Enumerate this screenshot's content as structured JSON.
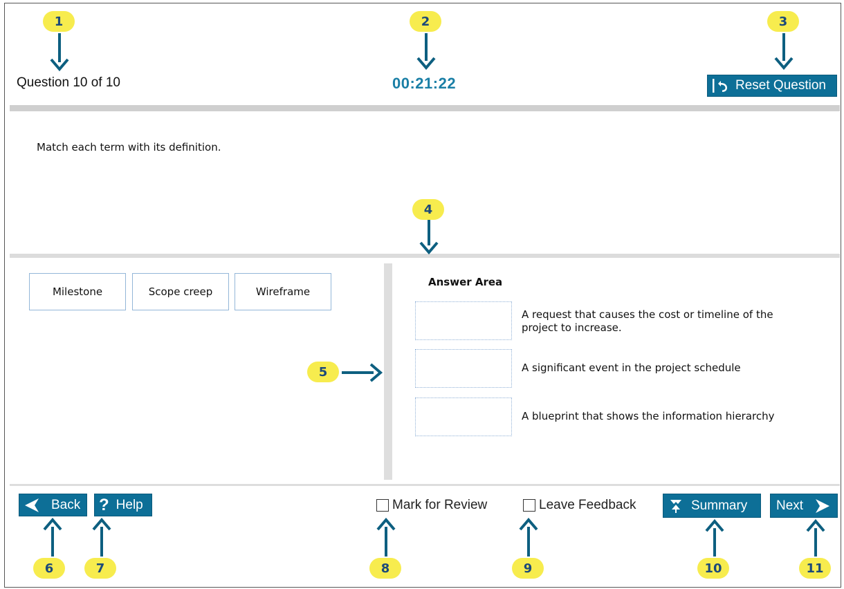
{
  "header": {
    "question_counter": "Question 10 of 10",
    "timer": "00:21:22",
    "reset_label": "Reset Question"
  },
  "instructions": "Match each term with its definition.",
  "items": [
    "Milestone",
    "Scope creep",
    "Wireframe"
  ],
  "answer_area": {
    "title": "Answer Area",
    "definitions": [
      "A request that causes the cost or timeline of the project to increase.",
      "A significant event in the project schedule",
      "A blueprint that shows the information hierarchy"
    ]
  },
  "footer": {
    "back_label": "Back",
    "help_label": "Help",
    "mark_review_label": "Mark for Review",
    "leave_feedback_label": "Leave Feedback",
    "summary_label": "Summary",
    "next_label": "Next"
  },
  "callouts": [
    "1",
    "2",
    "3",
    "4",
    "5",
    "6",
    "7",
    "8",
    "9",
    "10",
    "11"
  ],
  "colors": {
    "button_bg": "#0d6f97",
    "timer": "#1a7fa6",
    "callout_fill": "#f7ec4e",
    "callout_text": "#1c4a7a",
    "arrow": "#0d5f80"
  },
  "icons": [
    "reset-icon",
    "back-arrow-icon",
    "help-icon",
    "summary-icon",
    "next-arrow-icon"
  ]
}
